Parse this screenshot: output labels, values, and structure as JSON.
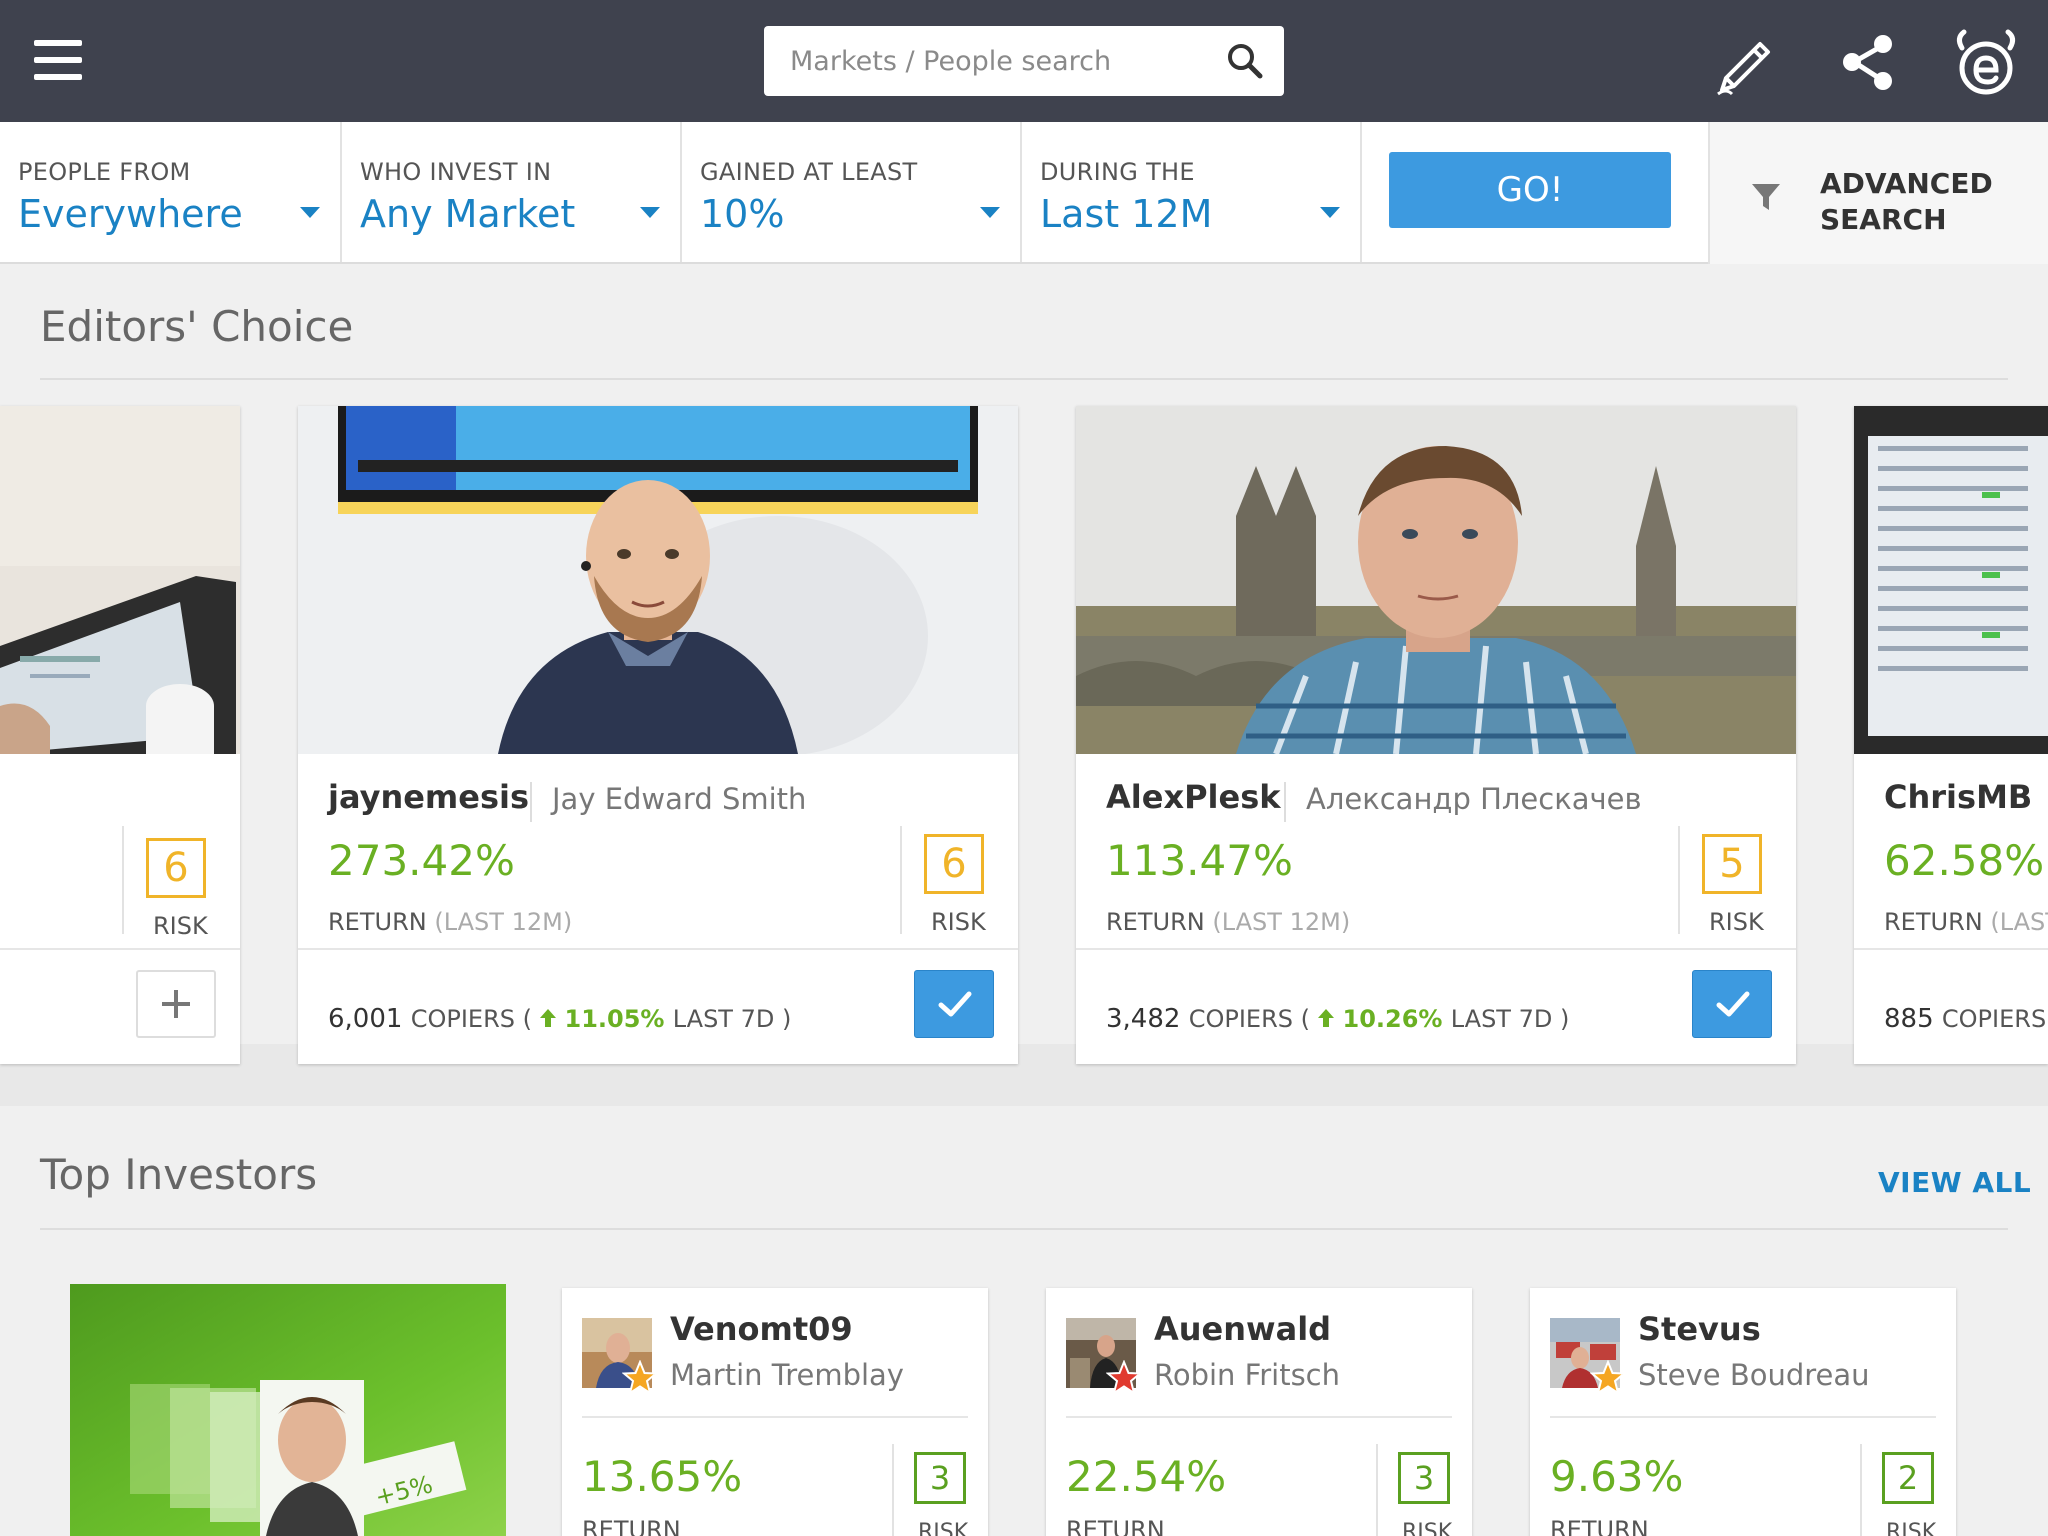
{
  "search": {
    "placeholder": "Markets / People search"
  },
  "filters": [
    {
      "label": "PEOPLE FROM",
      "value": "Everywhere"
    },
    {
      "label": "WHO INVEST IN",
      "value": "Any Market"
    },
    {
      "label": "GAINED AT LEAST",
      "value": "10%"
    },
    {
      "label": "DURING THE",
      "value": "Last 12M"
    }
  ],
  "go_label": "GO!",
  "advanced": {
    "line1": "ADVANCED",
    "line2": "SEARCH"
  },
  "editors_choice": {
    "title": "Editors' Choice",
    "partial_left": {
      "risk": "6",
      "risk_label": "RISK"
    },
    "cards": [
      {
        "username": "jaynemesis",
        "real_name": "Jay Edward Smith",
        "return": "273.42%",
        "return_label": "RETURN",
        "period": "(LAST 12M)",
        "risk": "6",
        "risk_label": "RISK",
        "copiers": "6,001",
        "copiers_label": "COPIERS (",
        "gain": "11.05%",
        "gain_suffix": "LAST 7D )"
      },
      {
        "username": "AlexPlesk",
        "real_name": "Александр Плескачев",
        "return": "113.47%",
        "return_label": "RETURN",
        "period": "(LAST 12M)",
        "risk": "5",
        "risk_label": "RISK",
        "copiers": "3,482",
        "copiers_label": "COPIERS (",
        "gain": "10.26%",
        "gain_suffix": "LAST 7D )"
      }
    ],
    "partial_right": {
      "username": "ChrisMB",
      "return": "62.58%",
      "return_label": "RETURN",
      "period": "(LAST",
      "copiers": "885",
      "copiers_label": "COPIERS ("
    }
  },
  "top_investors": {
    "title": "Top Investors",
    "view_all": "VIEW ALL",
    "cards": [
      {
        "username": "Venomt09",
        "real_name": "Martin Tremblay",
        "return": "13.65%",
        "return_label": "RETURN",
        "risk": "3",
        "risk_label": "RISK",
        "star_color": "#f5a623"
      },
      {
        "username": "Auenwald",
        "real_name": "Robin Fritsch",
        "return": "22.54%",
        "return_label": "RETURN",
        "risk": "3",
        "risk_label": "RISK",
        "star_color": "#e03a2f"
      },
      {
        "username": "Stevus",
        "real_name": "Steve Boudreau",
        "return": "9.63%",
        "return_label": "RETURN",
        "risk": "2",
        "risk_label": "RISK",
        "star_color": "#f5a623"
      }
    ],
    "promo_badge": "+5%"
  },
  "colors": {
    "topbar": "#3f424e",
    "accent": "#1a82c4",
    "button": "#3d9ae0",
    "gain": "#6ab023",
    "risk_high": "#f0b429",
    "risk_low": "#5aa020"
  }
}
